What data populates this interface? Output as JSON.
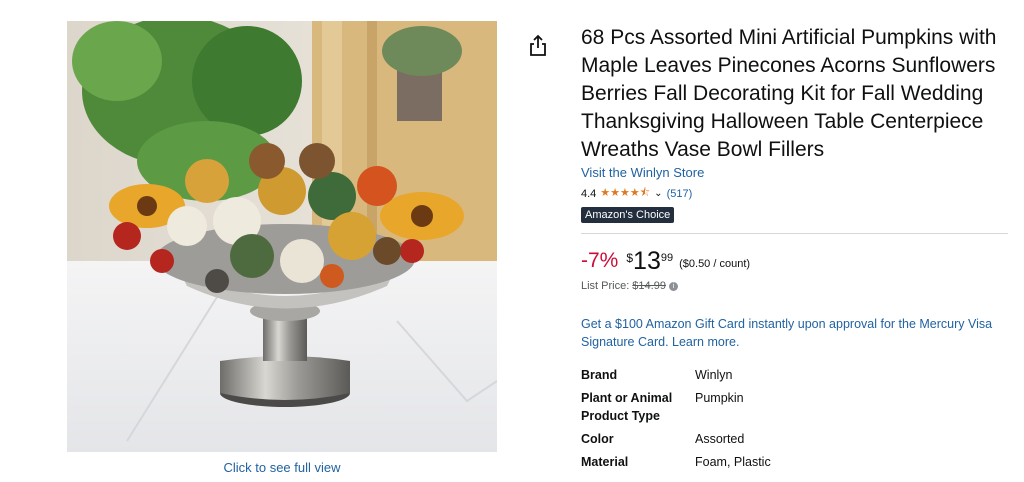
{
  "gallery": {
    "full_view_label": "Click to see full view"
  },
  "product": {
    "title": "68 Pcs Assorted Mini Artificial Pumpkins with Maple Leaves Pinecones Acorns Sunflowers Berries Fall Decorating Kit for Fall Wedding Thanksgiving Halloween Table Centerpiece Wreaths Vase Bowl Fillers",
    "store_link": "Visit the Winlyn Store",
    "rating": "4.4",
    "rating_value": 4.4,
    "stars": "★★★★⯪",
    "reviews": "(517)",
    "badge": "Amazon's Choice",
    "discount": "-7%",
    "currency": "$",
    "price_whole": "13",
    "price_fraction": "99",
    "unit_price": "($0.50 / count)",
    "list_price_label": "List Price:",
    "list_price_value": "$14.99",
    "promo": "Get a $100 Amazon Gift Card instantly upon approval for the Mercury Visa Signature Card. Learn more."
  },
  "specs": [
    {
      "key": "Brand",
      "value": "Winlyn"
    },
    {
      "key": "Plant or Animal Product Type",
      "value": "Pumpkin"
    },
    {
      "key": "Color",
      "value": "Assorted"
    },
    {
      "key": "Material",
      "value": "Foam, Plastic"
    }
  ],
  "colors": {
    "link": "#2162a1",
    "discount": "#cc0c39",
    "star": "#de7921",
    "badge_bg": "#232f3e"
  }
}
